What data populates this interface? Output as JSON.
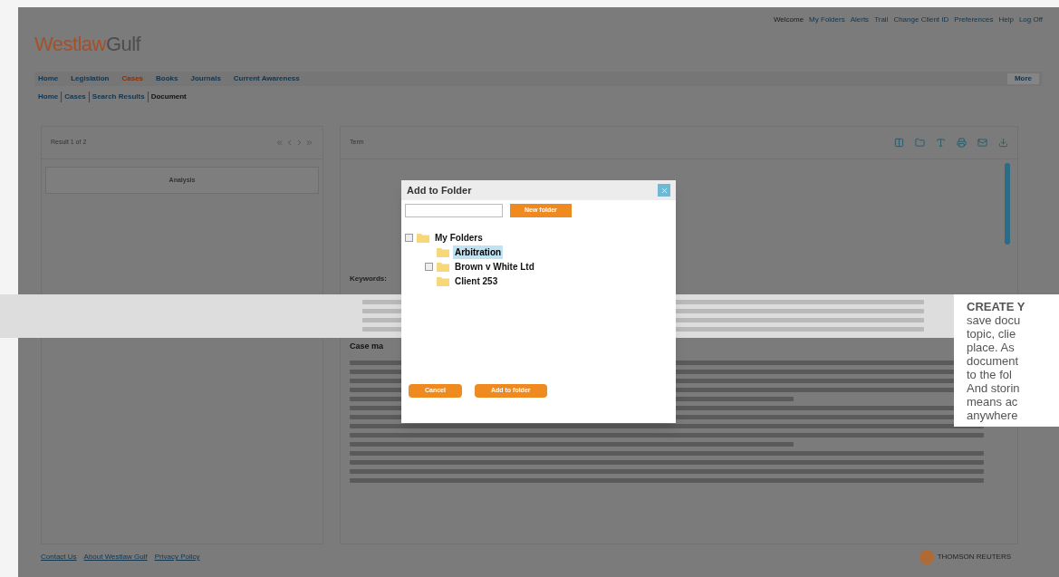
{
  "header": {
    "logo": {
      "part1": "Westlaw",
      "part2": "Gulf"
    },
    "links": [
      "Welcome",
      "My Folders",
      "Alerts",
      "Trail",
      "Change Client ID",
      "Preferences",
      "Help",
      "Log Off"
    ]
  },
  "nav": {
    "tabs": [
      {
        "label": "Home",
        "selected": false
      },
      {
        "label": "Legislation",
        "selected": false
      },
      {
        "label": "Cases",
        "selected": true
      },
      {
        "label": "Books",
        "selected": false
      },
      {
        "label": "Journals",
        "selected": false
      },
      {
        "label": "Current Awareness",
        "selected": false
      }
    ],
    "more": "More"
  },
  "breadcrumb": [
    {
      "label": "Home",
      "link": true
    },
    {
      "label": "Cases",
      "link": true
    },
    {
      "label": "Search Results",
      "link": true
    },
    {
      "label": "Document",
      "link": false
    }
  ],
  "results": {
    "counter": "Result 1 of 2",
    "analysis": "Analysis"
  },
  "toolbar": {
    "term": "Term"
  },
  "document": {
    "keywords": "Keywords:",
    "section": "Case ma"
  },
  "dialog": {
    "title": "Add to Folder",
    "new_folder": "New folder",
    "tree": [
      {
        "label": "My Folders",
        "expandable": true,
        "selected": false,
        "children": [
          {
            "label": "Arbitration",
            "expandable": false,
            "selected": true
          },
          {
            "label": "Brown v White Ltd",
            "expandable": true,
            "selected": false
          },
          {
            "label": "Client 253",
            "expandable": false,
            "selected": false
          }
        ]
      }
    ],
    "buttons": [
      "Cancel",
      "Add to folder"
    ]
  },
  "callout": {
    "heading": "CREATE Y",
    "lines": [
      "save docu",
      "topic, clie",
      "place. As",
      "document",
      "to the fol",
      "And storin",
      "means ac",
      "anywhere"
    ]
  },
  "footer": {
    "links": [
      "Contact Us",
      "About Westlaw Gulf",
      "Privacy Policy"
    ],
    "brand": "THOMSON REUTERS"
  }
}
